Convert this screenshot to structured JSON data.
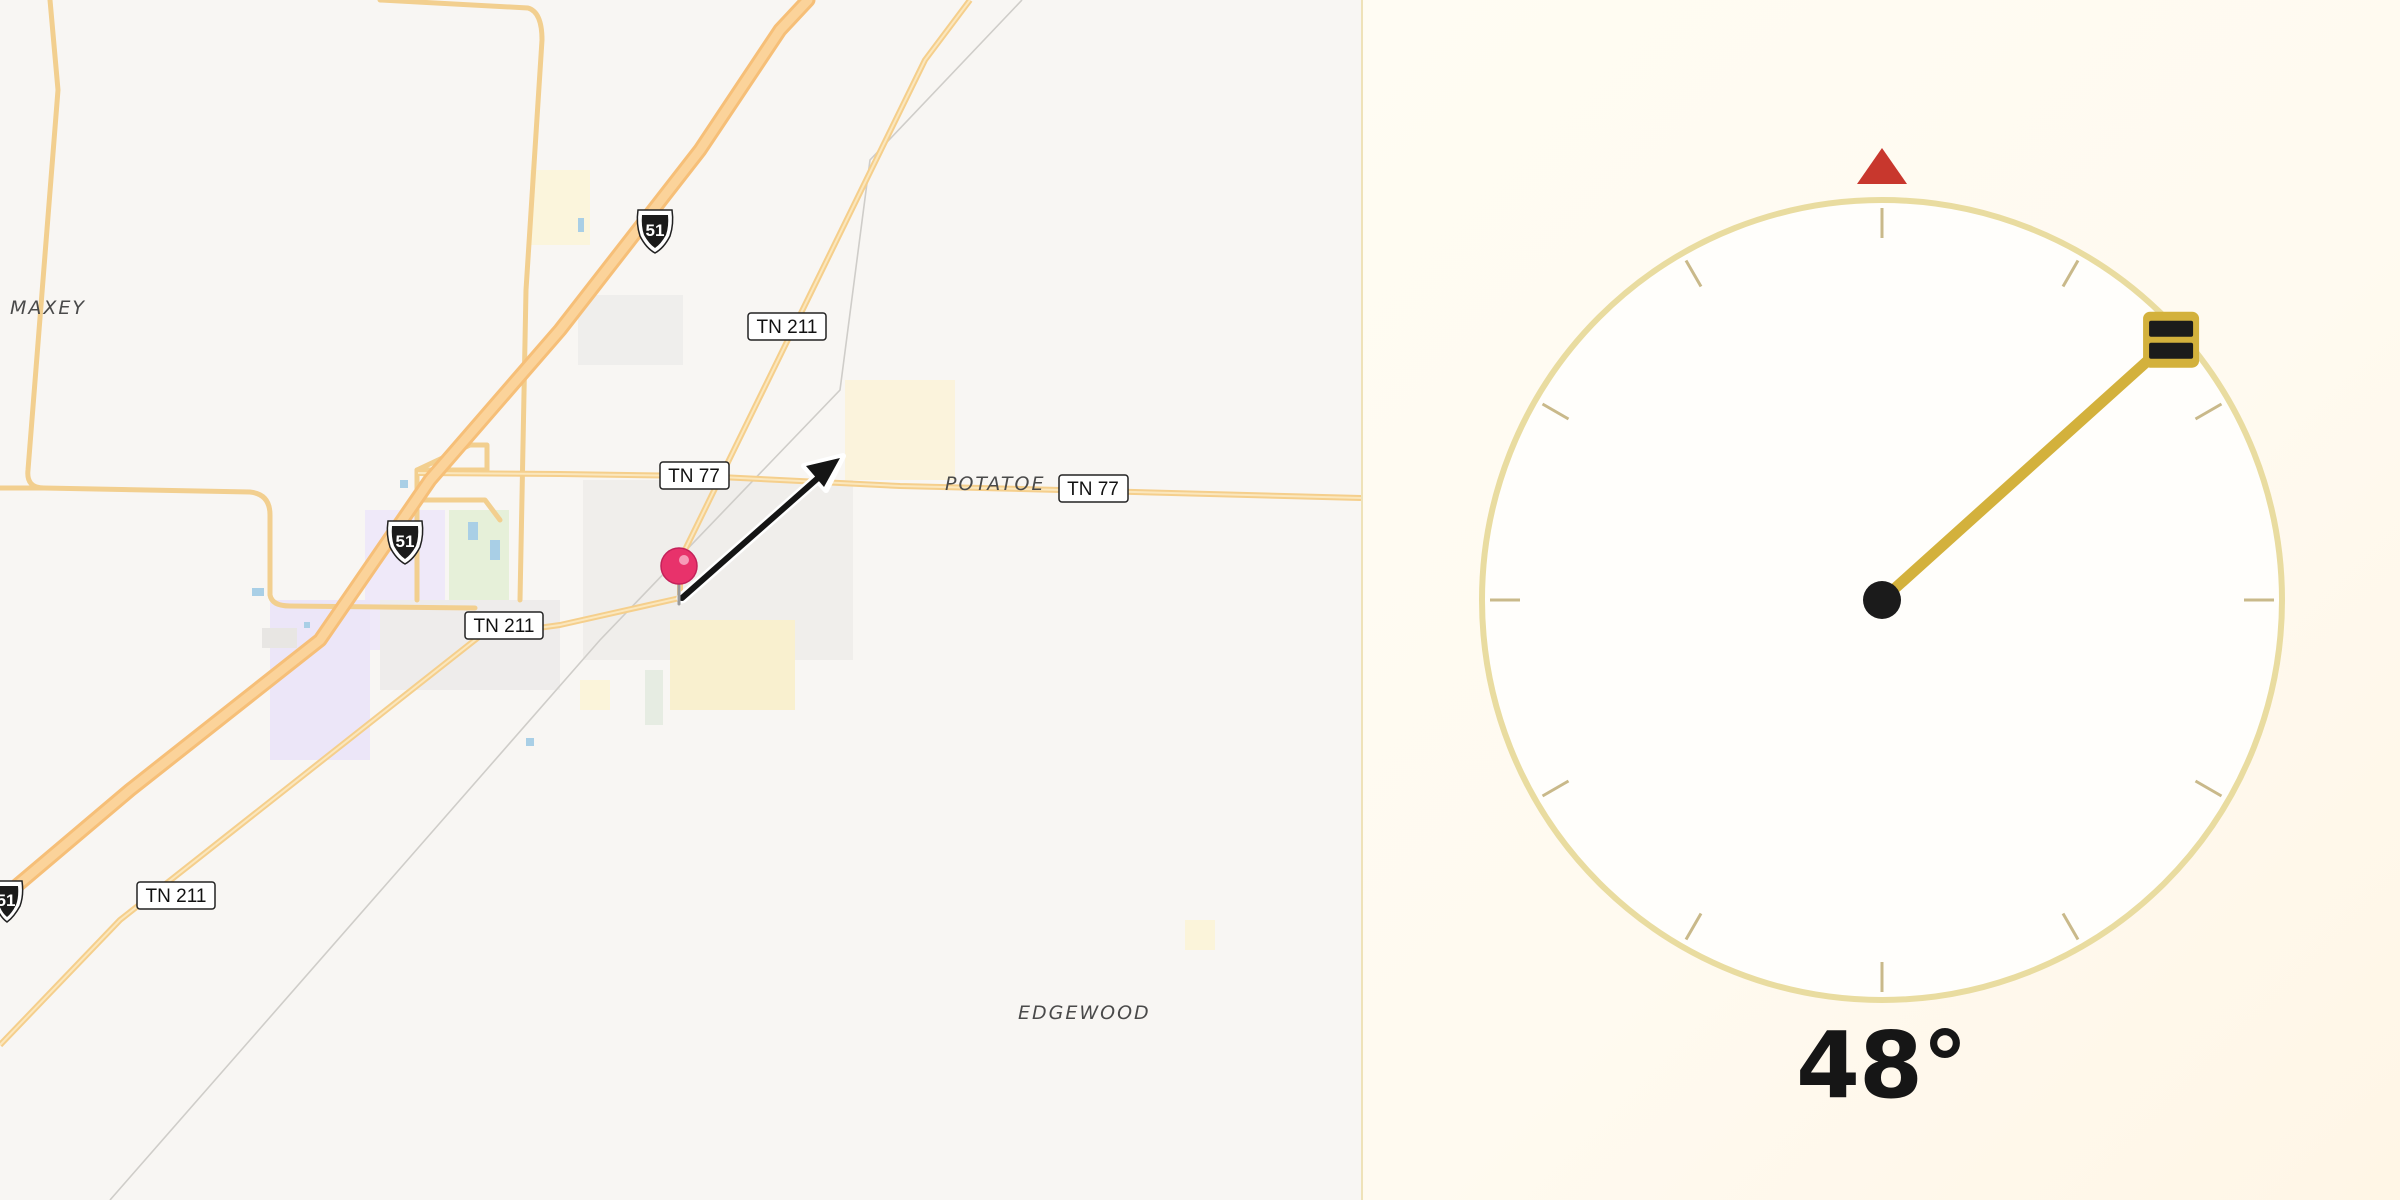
{
  "map": {
    "place_labels": {
      "maxey": "MAXEY",
      "potatoe": "POTATOE",
      "edgewood": "EDGEWOOD"
    },
    "shields": {
      "tn211_a": "TN 211",
      "tn211_b": "TN 211",
      "tn211_c": "TN 211",
      "tn77_a": "TN 77",
      "tn77_b": "TN 77",
      "us51_a": "51",
      "us51_b": "51",
      "us51_c": "51"
    },
    "marker_icon": "map-pin-icon",
    "direction_icon": "arrow-icon"
  },
  "dial": {
    "heading_value": 48,
    "heading_text": "48°",
    "north_marker_icon": "north-triangle-icon",
    "handle_icon": "drag-handle-icon",
    "colors": {
      "needle": "#d3b13c",
      "ring": "#e9dca0",
      "north": "#c8372d",
      "hub": "#1b1b1b"
    }
  }
}
